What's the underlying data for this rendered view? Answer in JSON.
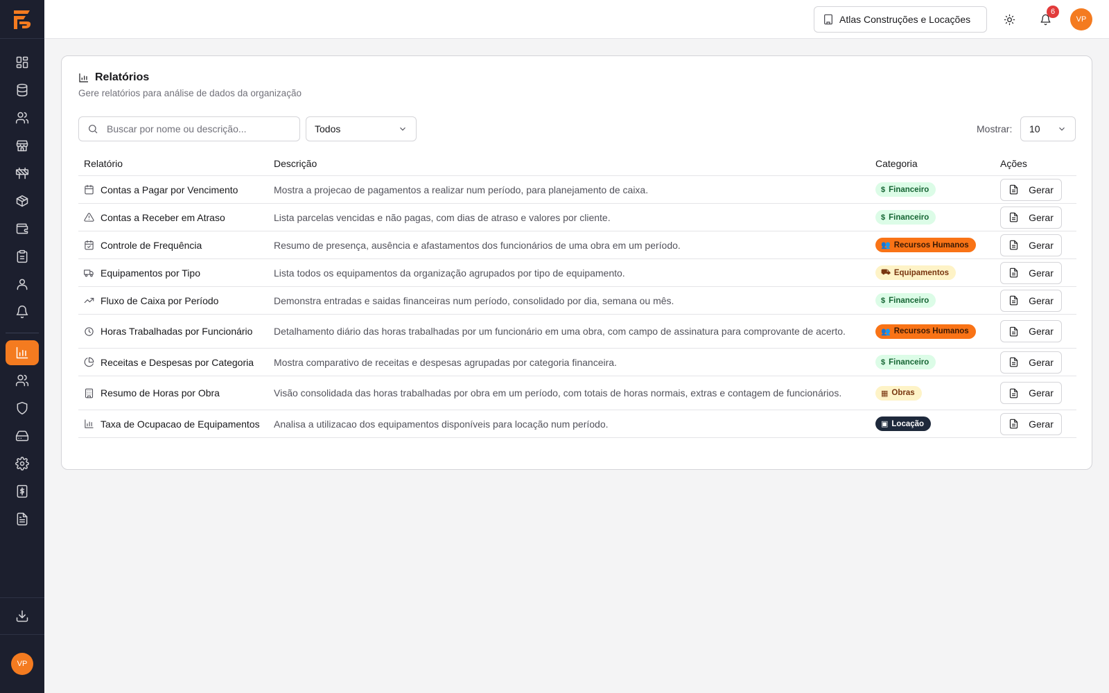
{
  "topbar": {
    "org_name": "Atlas Construções e Locações",
    "notification_count": "6",
    "avatar_initials": "VP"
  },
  "sidebar": {
    "avatar_initials": "VP",
    "items": [
      {
        "icon": "dashboard-icon"
      },
      {
        "icon": "database-icon"
      },
      {
        "icon": "users-icon"
      },
      {
        "icon": "store-icon"
      },
      {
        "icon": "construction-icon"
      },
      {
        "icon": "package-icon"
      },
      {
        "icon": "wallet-icon"
      },
      {
        "icon": "clipboard-icon"
      },
      {
        "icon": "user-icon"
      },
      {
        "icon": "bell-icon"
      },
      {
        "icon": "chart-icon",
        "active": true
      },
      {
        "icon": "team-icon"
      },
      {
        "icon": "shield-icon"
      },
      {
        "icon": "drive-icon"
      },
      {
        "icon": "settings-icon"
      },
      {
        "icon": "receipt-icon"
      },
      {
        "icon": "document-icon"
      }
    ]
  },
  "page": {
    "title": "Relatórios",
    "subtitle": "Gere relatórios para análise de dados da organização",
    "search_placeholder": "Buscar por nome ou descrição...",
    "filter_value": "Todos",
    "show_label": "Mostrar:",
    "page_size": "10"
  },
  "table": {
    "headers": {
      "name": "Relatório",
      "description": "Descrição",
      "category": "Categoria",
      "actions": "Ações"
    },
    "action_label": "Gerar",
    "rows": [
      {
        "name": "Contas a Pagar por Vencimento",
        "description": "Mostra a projecao de pagamentos a realizar num período, para planejamento de caixa.",
        "category": "Financeiro",
        "icon": "calendar-icon"
      },
      {
        "name": "Contas a Receber em Atraso",
        "description": "Lista parcelas vencidas e não pagas, com dias de atraso e valores por cliente.",
        "category": "Financeiro",
        "icon": "alert-triangle-icon"
      },
      {
        "name": "Controle de Frequência",
        "description": "Resumo de presença, ausência e afastamentos dos funcionários de uma obra em um período.",
        "category": "Recursos Humanos",
        "icon": "calendar-check-icon"
      },
      {
        "name": "Equipamentos por Tipo",
        "description": "Lista todos os equipamentos da organização agrupados por tipo de equipamento.",
        "category": "Equipamentos",
        "icon": "truck-icon"
      },
      {
        "name": "Fluxo de Caixa por Período",
        "description": "Demonstra entradas e saidas financeiras num período, consolidado por dia, semana ou mês.",
        "category": "Financeiro",
        "icon": "trending-up-icon"
      },
      {
        "name": "Horas Trabalhadas por Funcionário",
        "description": "Detalhamento diário das horas trabalhadas por um funcionário em uma obra, com campo de assinatura para comprovante de acerto.",
        "category": "Recursos Humanos",
        "icon": "clock-icon"
      },
      {
        "name": "Receitas e Despesas por Categoria",
        "description": "Mostra comparativo de receitas e despesas agrupadas por categoria financeira.",
        "category": "Financeiro",
        "icon": "pie-chart-icon"
      },
      {
        "name": "Resumo de Horas por Obra",
        "description": "Visão consolidada das horas trabalhadas por obra em um período, com totais de horas normais, extras e contagem de funcionários.",
        "category": "Obras",
        "icon": "building-icon"
      },
      {
        "name": "Taxa de Ocupacao de Equipamentos",
        "description": "Analisa a utilizacao dos equipamentos disponíveis para locação num período.",
        "category": "Locação",
        "icon": "bar-chart-icon"
      }
    ]
  },
  "colors": {
    "accent": "#f47b20",
    "sidebar_bg": "#1c1f2e",
    "badge_financeiro": "#dcfce7",
    "badge_rh": "#f97316",
    "badge_equipamentos": "#fef3c7",
    "badge_locacao": "#1e293b"
  }
}
